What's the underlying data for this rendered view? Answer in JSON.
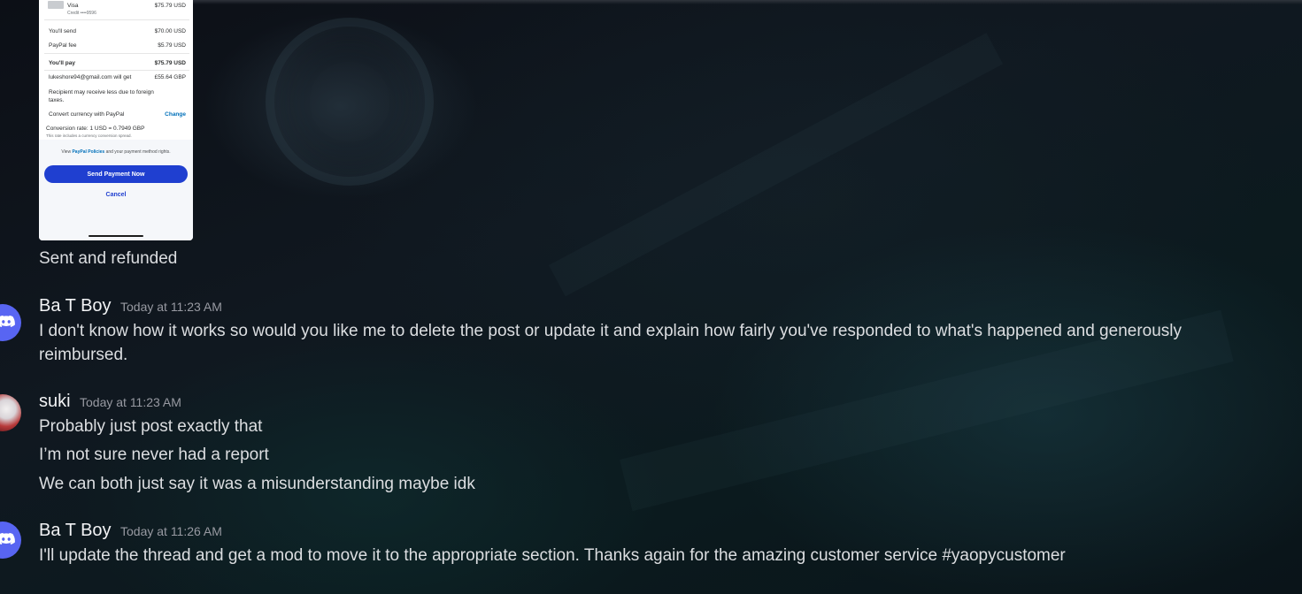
{
  "attachment": {
    "card_name": "Visa",
    "card_sub": "Credit ••••9596",
    "card_amount": "$75.79 USD",
    "rows": [
      {
        "label": "You'll send",
        "value": "$70.00 USD"
      },
      {
        "label": "PayPal fee",
        "value": "$5.79 USD"
      },
      {
        "label": "You'll pay",
        "value": "$75.79 USD"
      },
      {
        "label": "lukeshore94@gmail.com will get",
        "value": "£55.64 GBP"
      }
    ],
    "foreign_note": "Recipient may receive less due to foreign taxes.",
    "convert_label": "Convert currency with PayPal",
    "convert_link": "Change",
    "rate": "Conversion rate: 1 USD = 0.7949 GBP",
    "rate_note": "This rate includes a currency conversion spread.",
    "policy_prefix": "View",
    "policy_link": "PayPal Policies",
    "policy_suffix": "and your payment method rights.",
    "send_button": "Send Payment Now",
    "cancel": "Cancel"
  },
  "messages": [
    {
      "text": "Sent and refunded"
    },
    {
      "author": "Ba T Boy",
      "time": "Today at 11:23 AM",
      "lines": [
        "I don't know how it works so would you like me to delete the post or update it and explain how fairly you've responded to what's happened and generously reimbursed."
      ]
    },
    {
      "author": "suki",
      "time": "Today at 11:23 AM",
      "lines": [
        "Probably just post exactly that",
        "I’m not sure never had a report",
        "We can both just say it was a misunderstanding maybe idk"
      ]
    },
    {
      "author": "Ba T Boy",
      "time": "Today at 11:26 AM",
      "lines": [
        "I'll update the thread and get a mod to move it to the appropriate section. Thanks again for the amazing customer service #yaopycustomer"
      ]
    }
  ],
  "icons": {
    "discord_avatar": "discord-logo-icon",
    "suki_avatar": "user-avatar"
  },
  "colors": {
    "discord_blurple": "#5865f2",
    "paypal_button": "#1f3fd0",
    "username": "#f2f3f5",
    "timestamp": "#989aa2"
  }
}
